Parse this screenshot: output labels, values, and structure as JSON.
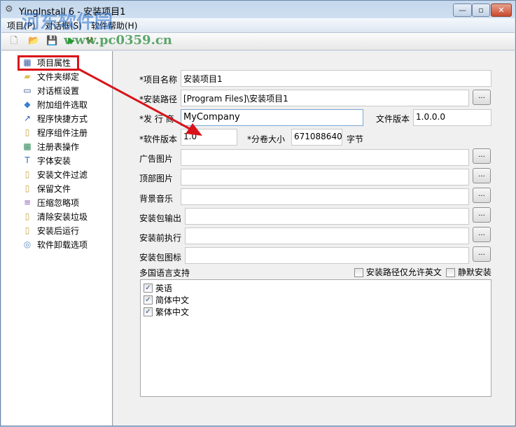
{
  "window": {
    "title": "YingInstall 6 - 安装项目1",
    "minimize": "—",
    "maximize": "▫",
    "close": "✕"
  },
  "watermark": {
    "text": "河东软件园",
    "url": "www.pc0359.cn"
  },
  "menu": [
    "项目(P)",
    "对话框(S)",
    "软件帮助(H)"
  ],
  "toolbar": [
    "new",
    "open",
    "save",
    "run",
    "build"
  ],
  "tree": [
    {
      "label": "项目属性",
      "icon": "grid-icon"
    },
    {
      "label": "文件夹绑定",
      "icon": "folder-icon"
    },
    {
      "label": "对话框设置",
      "icon": "window-icon"
    },
    {
      "label": "附加组件选取",
      "icon": "package-icon"
    },
    {
      "label": "程序快捷方式",
      "icon": "shortcut-icon"
    },
    {
      "label": "程序组件注册",
      "icon": "component-icon"
    },
    {
      "label": "注册表操作",
      "icon": "registry-icon"
    },
    {
      "label": "字体安装",
      "icon": "font-icon"
    },
    {
      "label": "安装文件过滤",
      "icon": "component-icon"
    },
    {
      "label": "保留文件",
      "icon": "component-icon"
    },
    {
      "label": "压缩忽略项",
      "icon": "archive-icon"
    },
    {
      "label": "清除安装垃圾",
      "icon": "component-icon"
    },
    {
      "label": "安装后运行",
      "icon": "component-icon"
    },
    {
      "label": "软件卸载选项",
      "icon": "uninstall-icon"
    }
  ],
  "form": {
    "project_name_label": "*项目名称",
    "project_name": "安装项目1",
    "install_path_label": "*安装路径",
    "install_path": "[Program Files]\\安装项目1",
    "publisher_label": "*发 行 商",
    "publisher": "MyCompany",
    "file_version_label": "文件版本",
    "file_version": "1.0.0.0",
    "software_version_label": "*软件版本",
    "software_version": "1.0",
    "volume_size_label": "*分卷大小",
    "volume_size": "671088640",
    "volume_unit": "字节",
    "ad_image_label": "广告图片",
    "top_image_label": "顶部图片",
    "bg_music_label": "背景音乐",
    "output_label": "安装包输出",
    "pre_exec_label": "安装前执行",
    "icon_label": "安装包图标",
    "browse": "...",
    "lang_label": "多国语言支持",
    "english_only_label": "安装路径仅允许英文",
    "silent_label": "静默安装",
    "languages": [
      {
        "label": "英语",
        "checked": true
      },
      {
        "label": "简体中文",
        "checked": true
      },
      {
        "label": "繁体中文",
        "checked": true
      }
    ],
    "check_mark": "✓"
  }
}
